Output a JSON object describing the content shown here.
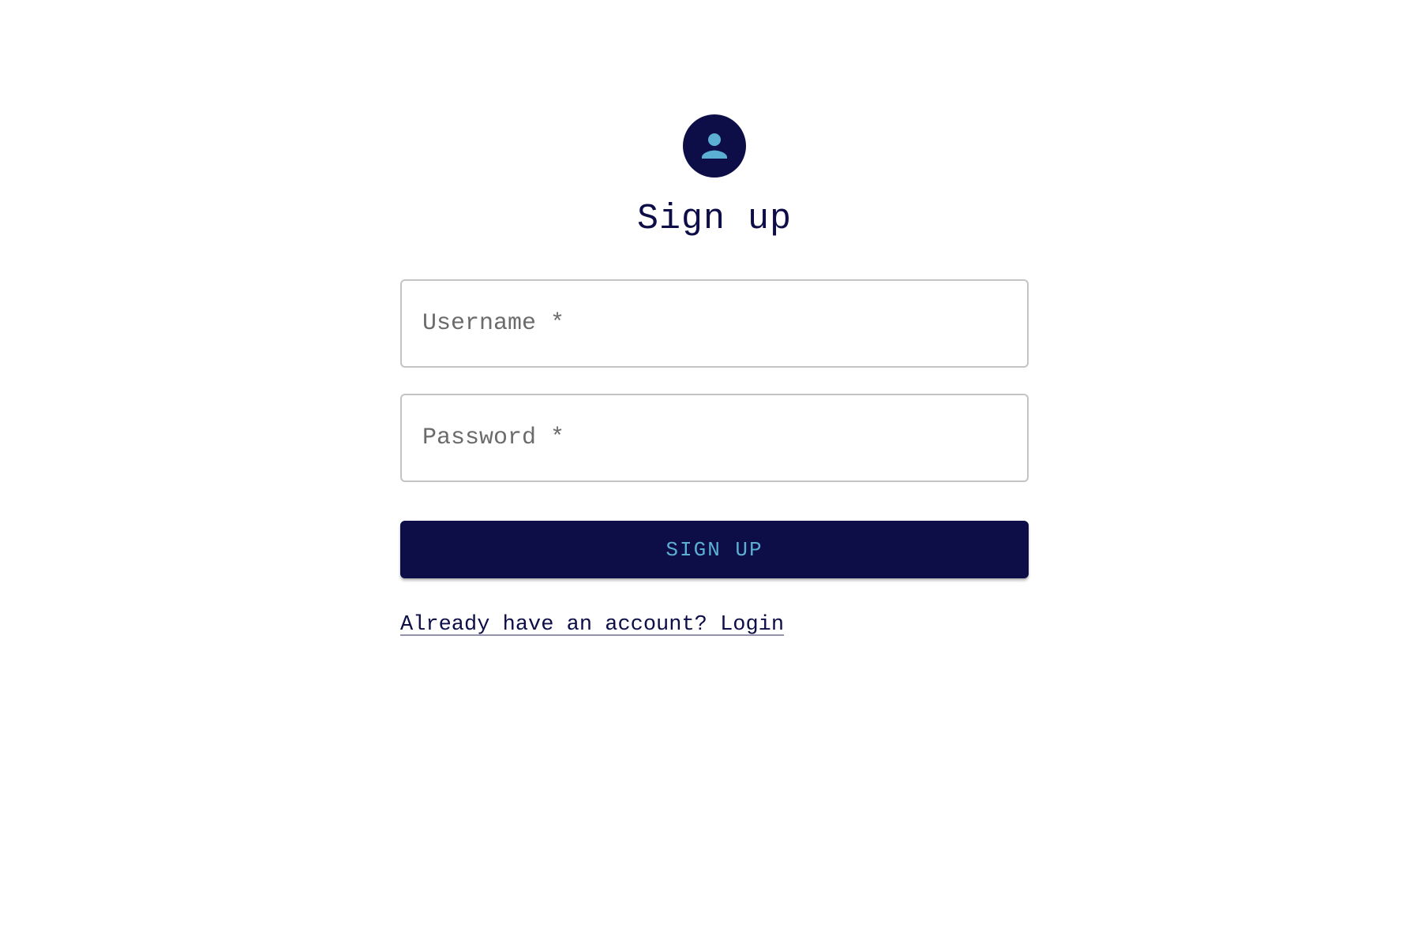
{
  "page": {
    "title": "Sign up"
  },
  "avatar": {
    "icon": "person-icon",
    "background_color": "#0d0d48",
    "icon_color": "#5bafd2"
  },
  "form": {
    "username": {
      "placeholder": "Username *",
      "value": ""
    },
    "password": {
      "placeholder": "Password *",
      "value": ""
    },
    "submit_label": "SIGN UP"
  },
  "footer": {
    "login_link_text": "Already have an account? Login"
  },
  "colors": {
    "primary": "#0d0d48",
    "accent": "#5bafd2",
    "border": "#c4c4c4"
  }
}
